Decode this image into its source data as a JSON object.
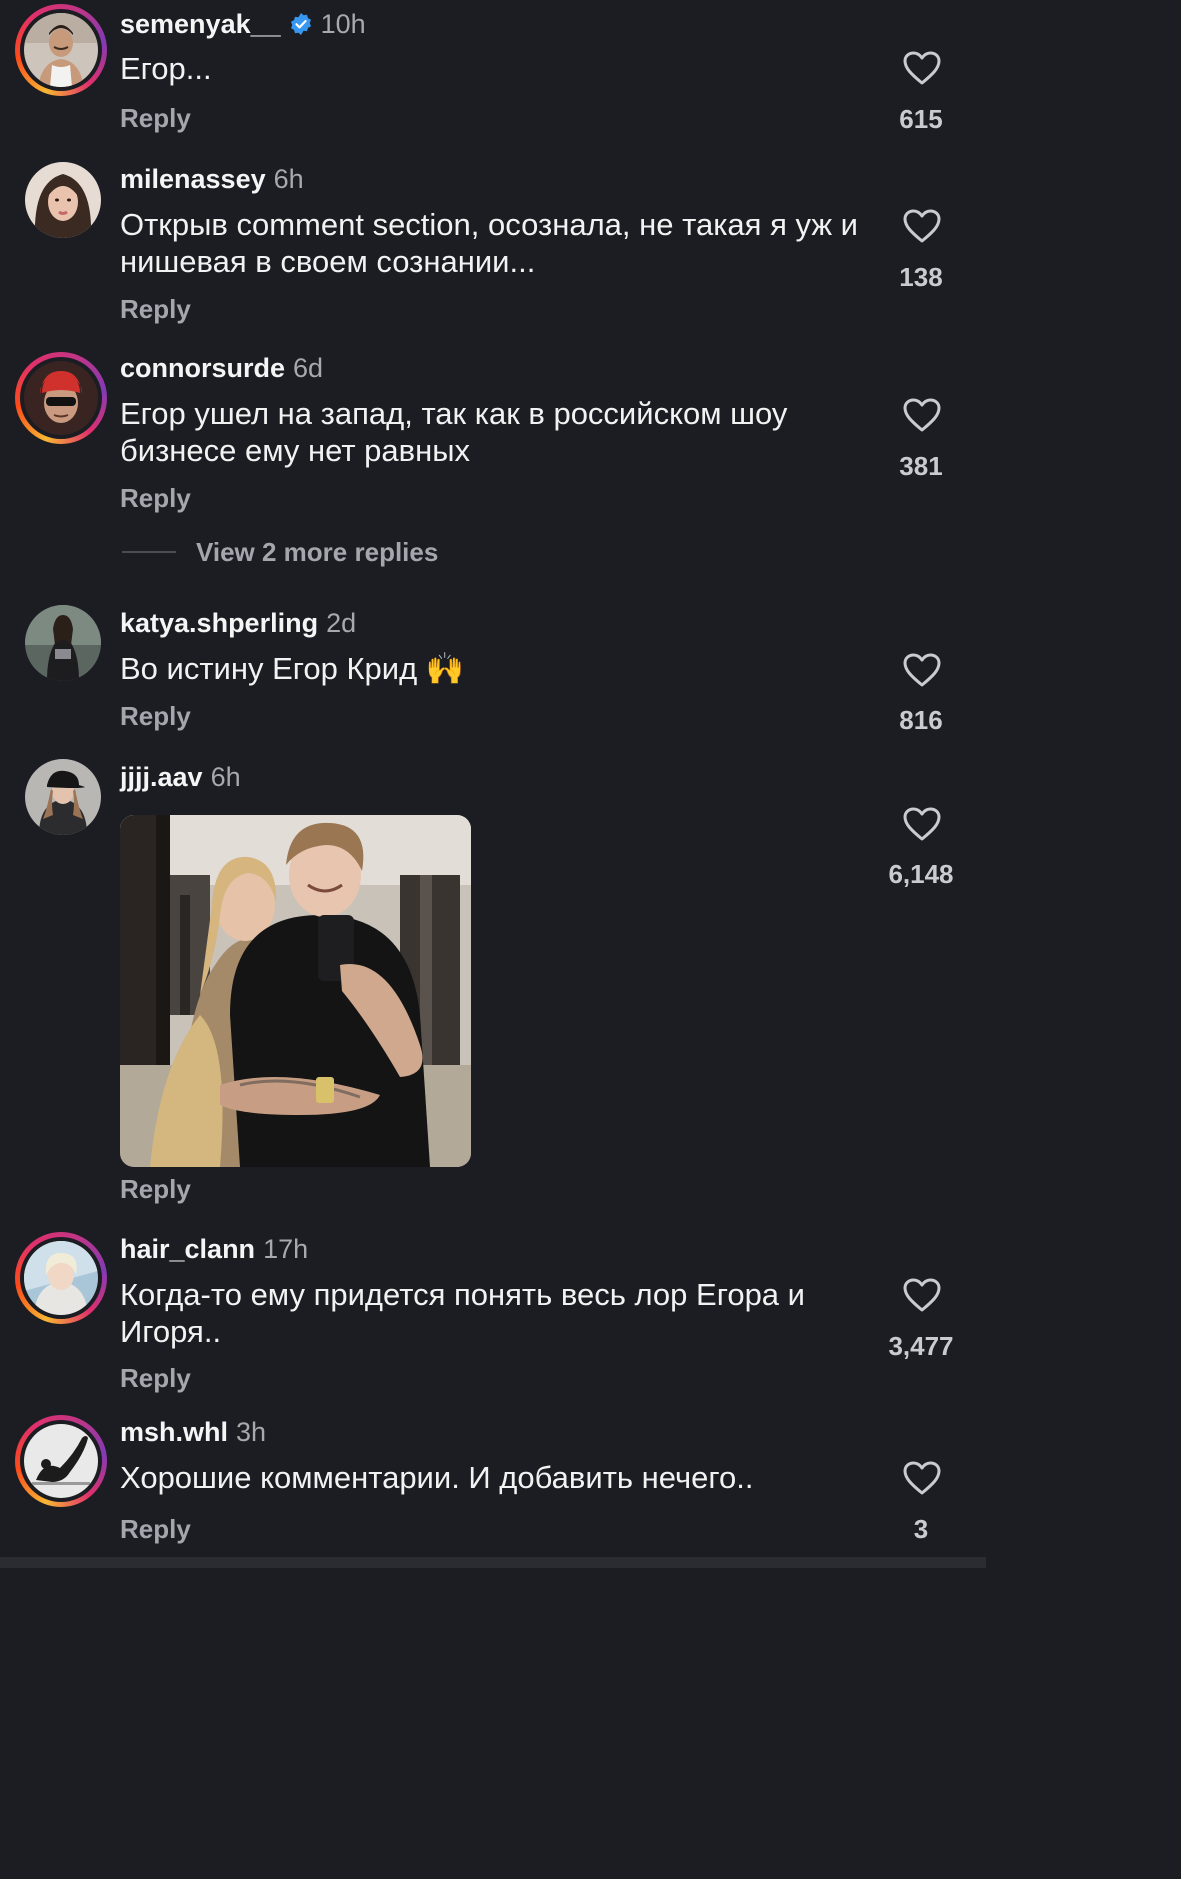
{
  "comments": [
    {
      "username": "semenyak__",
      "time": "10h",
      "verified": true,
      "text": "Егор...",
      "reply_label": "Reply",
      "likes": "615",
      "avatar_icon": "avatar-man-tank-top"
    },
    {
      "username": "milenassey",
      "time": "6h",
      "verified": false,
      "text": "Открыв comment section, осознала, не такая я уж и нишевая в своем сознании...",
      "reply_label": "Reply",
      "likes": "138",
      "avatar_icon": "avatar-woman-portrait"
    },
    {
      "username": "connorsurde",
      "time": "6d",
      "verified": false,
      "text": "Егор ушел на запад, так как в российском шоу бизнесе ему нет равных",
      "reply_label": "Reply",
      "likes": "381",
      "avatar_icon": "avatar-man-red-beanie-sunglasses",
      "view_more": "View 2 more replies"
    },
    {
      "username": "katya.shperling",
      "time": "2d",
      "verified": false,
      "text": "Во истину Егор Крид 🙌",
      "reply_label": "Reply",
      "likes": "816",
      "avatar_icon": "avatar-woman-dark-outfit"
    },
    {
      "username": "jjjj.aav",
      "time": "6h",
      "verified": false,
      "text": "",
      "reply_label": "Reply",
      "likes": "6,148",
      "avatar_icon": "avatar-woman-cap",
      "image_icon": "couple-mirror-selfie-photo"
    },
    {
      "username": "hair_clann",
      "time": "17h",
      "verified": false,
      "text": "Когда-то ему придется понять весь лор Егора и Игоря..",
      "reply_label": "Reply",
      "likes": "3,477",
      "avatar_icon": "avatar-blonde-person"
    },
    {
      "username": "msh.whl",
      "time": "3h",
      "verified": false,
      "text": "Хорошие комментарии. И добавить нечего..",
      "reply_label": "Reply",
      "likes": "3",
      "avatar_icon": "avatar-yoga-silhouette"
    }
  ],
  "colors": {
    "background": "#1b1d22",
    "verified_badge": "#3897f0",
    "muted_text": "#a7a9ae",
    "story_ring_start": "#f7b733",
    "story_ring_end": "#c13584"
  }
}
